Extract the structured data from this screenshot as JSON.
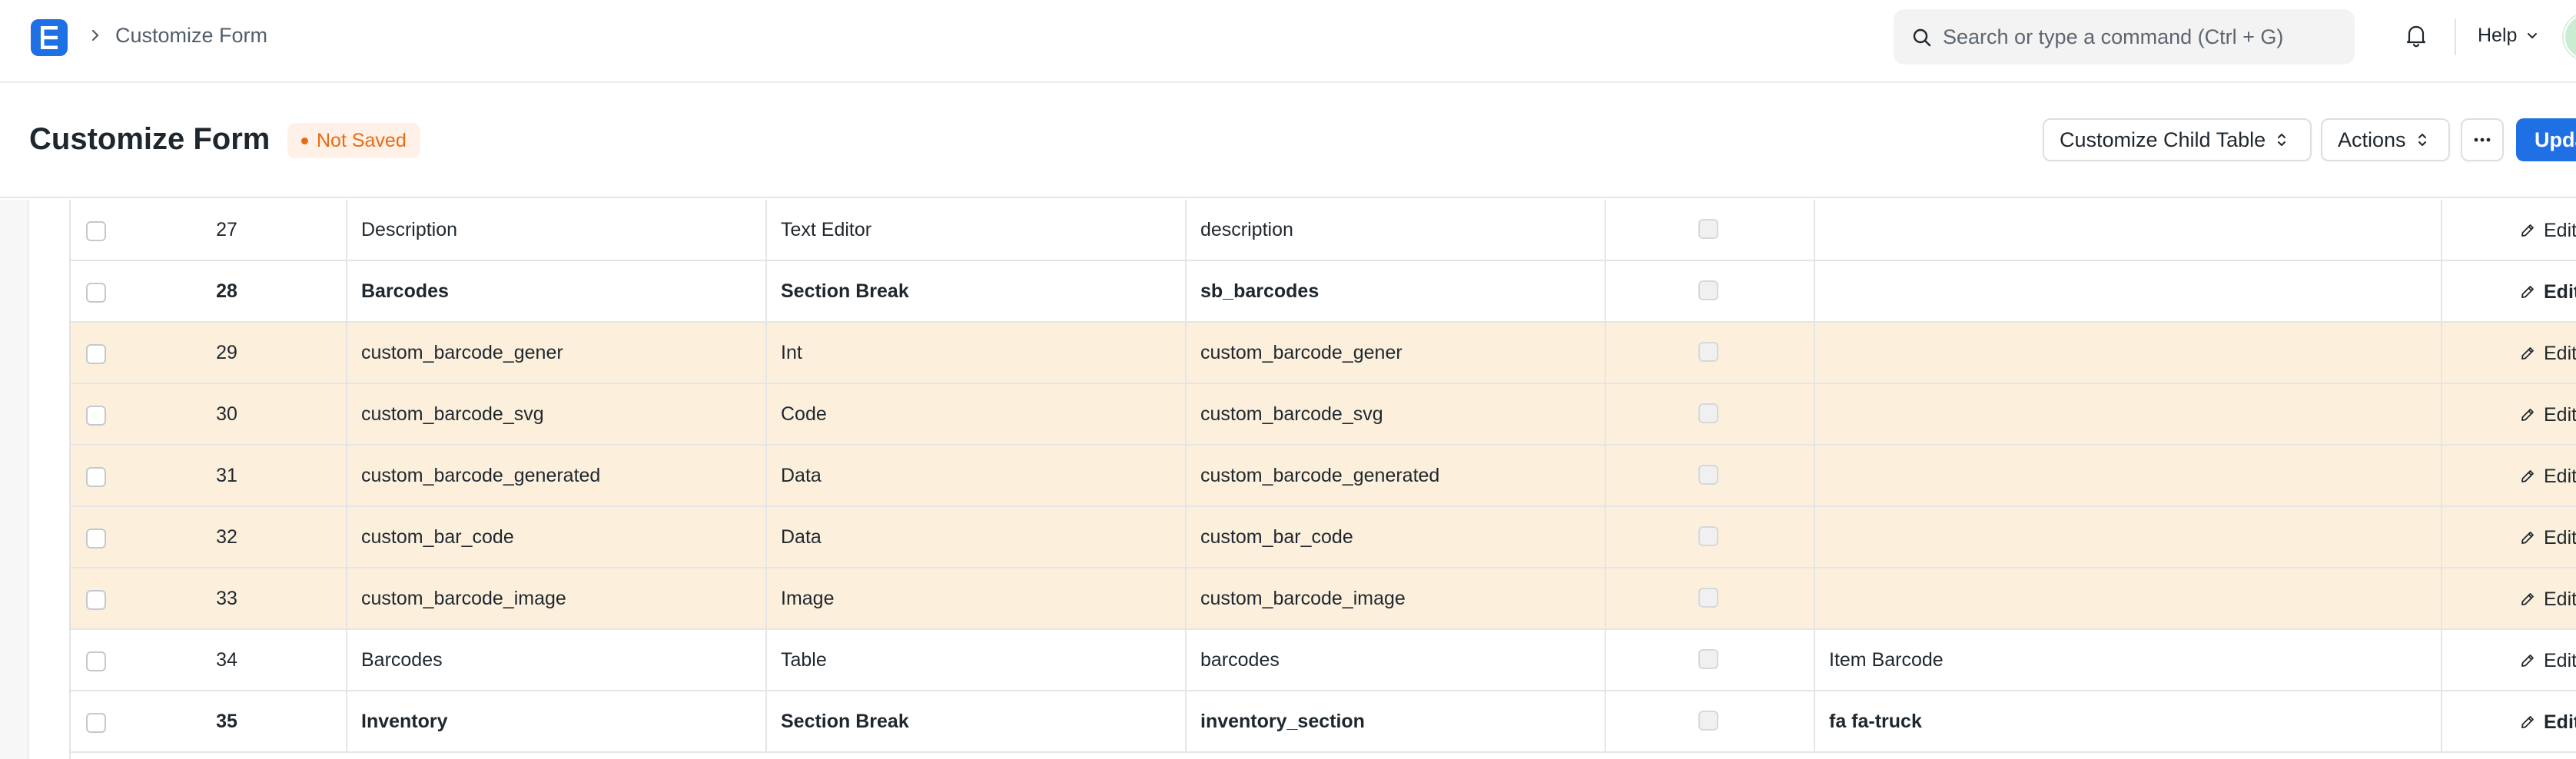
{
  "navbar": {
    "breadcrumb": "Customize Form",
    "search_placeholder": "Search or type a command (Ctrl + G)",
    "help_label": "Help"
  },
  "page": {
    "title": "Customize Form",
    "status": "Not Saved",
    "buttons": {
      "customize_child_table": "Customize Child Table",
      "actions": "Actions",
      "primary": "Update"
    }
  },
  "colors": {
    "brand": "#1f6fe5",
    "status_orange": "#e86c13",
    "highlight_row": "#fcf0dd"
  },
  "table": {
    "edit_label": "Edit",
    "rows": [
      {
        "idx": "27",
        "label": "Description",
        "type": "Text Editor",
        "fieldname": "description",
        "options": "",
        "bold": false,
        "highlight": false
      },
      {
        "idx": "28",
        "label": "Barcodes",
        "type": "Section Break",
        "fieldname": "sb_barcodes",
        "options": "",
        "bold": true,
        "highlight": false
      },
      {
        "idx": "29",
        "label": "custom_barcode_gener",
        "type": "Int",
        "fieldname": "custom_barcode_gener",
        "options": "",
        "bold": false,
        "highlight": true
      },
      {
        "idx": "30",
        "label": "custom_barcode_svg",
        "type": "Code",
        "fieldname": "custom_barcode_svg",
        "options": "",
        "bold": false,
        "highlight": true
      },
      {
        "idx": "31",
        "label": "custom_barcode_generated",
        "type": "Data",
        "fieldname": "custom_barcode_generated",
        "options": "",
        "bold": false,
        "highlight": true
      },
      {
        "idx": "32",
        "label": "custom_bar_code",
        "type": "Data",
        "fieldname": "custom_bar_code",
        "options": "",
        "bold": false,
        "highlight": true
      },
      {
        "idx": "33",
        "label": "custom_barcode_image",
        "type": "Image",
        "fieldname": "custom_barcode_image",
        "options": "",
        "bold": false,
        "highlight": true
      },
      {
        "idx": "34",
        "label": "Barcodes",
        "type": "Table",
        "fieldname": "barcodes",
        "options": "Item Barcode",
        "bold": false,
        "highlight": false
      },
      {
        "idx": "35",
        "label": "Inventory",
        "type": "Section Break",
        "fieldname": "inventory_section",
        "options": "fa fa-truck",
        "bold": true,
        "highlight": false
      }
    ]
  }
}
